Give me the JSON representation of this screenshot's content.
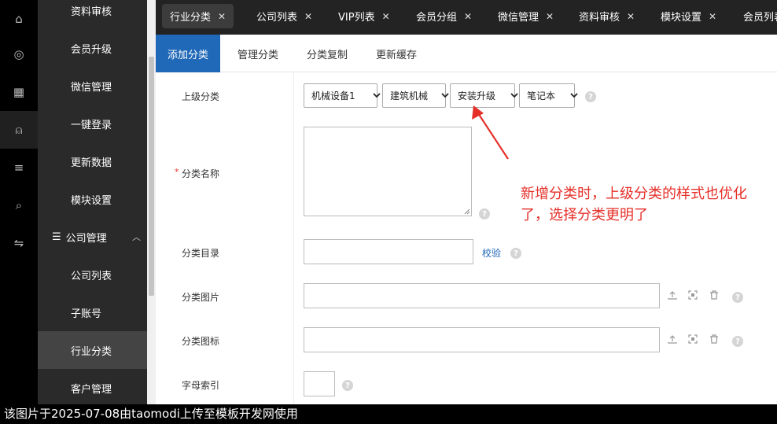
{
  "rail": {
    "items": [
      {
        "icon": "home-icon",
        "glyph": "⌂"
      },
      {
        "icon": "gear-icon",
        "glyph": "◎"
      },
      {
        "icon": "grid-icon",
        "glyph": "▦"
      },
      {
        "icon": "user-icon",
        "glyph": "⍝"
      },
      {
        "icon": "list-icon",
        "glyph": "≡"
      },
      {
        "icon": "search-icon",
        "glyph": "⌕"
      },
      {
        "icon": "switch-icon",
        "glyph": "⇋"
      }
    ]
  },
  "sidebar": {
    "items": [
      {
        "label": "资料审核"
      },
      {
        "label": "会员升级"
      },
      {
        "label": "微信管理"
      },
      {
        "label": "一键登录"
      },
      {
        "label": "更新数据"
      },
      {
        "label": "模块设置"
      },
      {
        "label": "公司管理",
        "group": true
      },
      {
        "label": "公司列表"
      },
      {
        "label": "子账号"
      },
      {
        "label": "行业分类",
        "active": true
      },
      {
        "label": "客户管理"
      }
    ]
  },
  "tabs": [
    {
      "label": "行业分类",
      "active": true
    },
    {
      "label": "公司列表"
    },
    {
      "label": "VIP列表"
    },
    {
      "label": "会员分组"
    },
    {
      "label": "微信管理"
    },
    {
      "label": "资料审核"
    },
    {
      "label": "模块设置"
    },
    {
      "label": "会员列表"
    }
  ],
  "subtabs": [
    {
      "label": "添加分类",
      "active": true
    },
    {
      "label": "管理分类"
    },
    {
      "label": "分类复制"
    },
    {
      "label": "更新缓存"
    }
  ],
  "form": {
    "parent_label": "上级分类",
    "parent_selects": [
      "机械设备1",
      "建筑机械",
      "安装升级",
      "笔记本"
    ],
    "name_label": "分类名称",
    "name_required_mark": "*",
    "dir_label": "分类目录",
    "dir_check_link": "校验",
    "image_label": "分类图片",
    "icon_label": "分类图标",
    "letter_label": "字母索引",
    "help_glyph": "?"
  },
  "annotation": {
    "text": "新增分类时，上级分类的样式也优化了，选择分类更明了",
    "color": "#e5302a"
  },
  "footer": {
    "text": "该图片于2025-07-08由taomodi上传至模板开发网使用"
  },
  "colors": {
    "accent": "#2068b8",
    "sidebar_bg": "#2a2a2a",
    "rail_bg": "#000000",
    "tabs_bg": "#232323"
  }
}
